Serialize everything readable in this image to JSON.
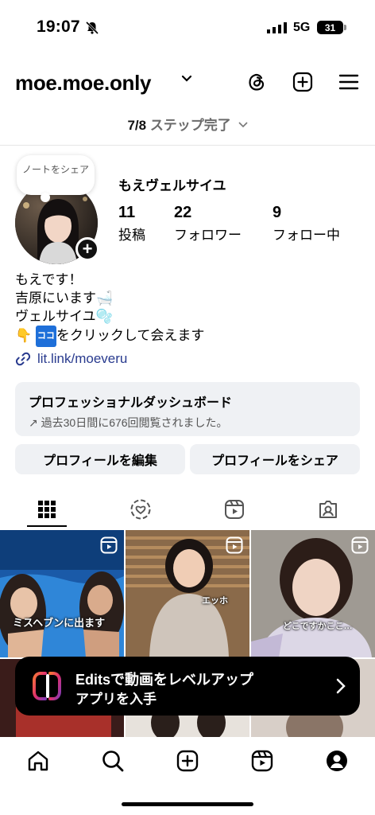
{
  "status_bar": {
    "time": "19:07",
    "network": "5G",
    "battery": "31"
  },
  "header": {
    "username": "moe.moe.only"
  },
  "steps": {
    "progress": "7/8",
    "label": "ステップ完了"
  },
  "profile": {
    "note": "ノートをシェア",
    "display_name": "もえヴェルサイユ",
    "stats": [
      {
        "value": "11",
        "label": "投稿"
      },
      {
        "value": "22",
        "label": "フォロワー"
      },
      {
        "value": "9",
        "label": "フォロー中"
      }
    ],
    "bio": {
      "line1": "もえです！",
      "line2": "吉原にいます🛁",
      "line3": "ヴェルサイユ🫧",
      "line4_prefix": "👇",
      "line4_badge": "ココ",
      "line4_suffix": "をクリックして会えます"
    },
    "link": "lit.link/moeveru"
  },
  "dashboard": {
    "title": "プロフェッショナルダッシュボード",
    "subtitle": "↗ 過去30日間に676回閲覧されました。"
  },
  "buttons": {
    "edit_profile": "プロフィールを編集",
    "share_profile": "プロフィールをシェア"
  },
  "tabs": [
    "grid-icon",
    "reposts-icon",
    "reels-icon",
    "tagged-icon"
  ],
  "grid": {
    "captions": [
      "ミスヘブンに出ます",
      "エッホ",
      "どこですかここ…"
    ]
  },
  "edits_banner": {
    "title": "Editsで動画をレベルアップ",
    "subtitle": "アプリを入手"
  },
  "bottom_nav": [
    "home-icon",
    "search-icon",
    "create-icon",
    "reels-icon",
    "profile-icon"
  ],
  "colors": {
    "link": "#283a8e",
    "card_bg": "#eff1f4",
    "banner_bg": "#000000"
  }
}
